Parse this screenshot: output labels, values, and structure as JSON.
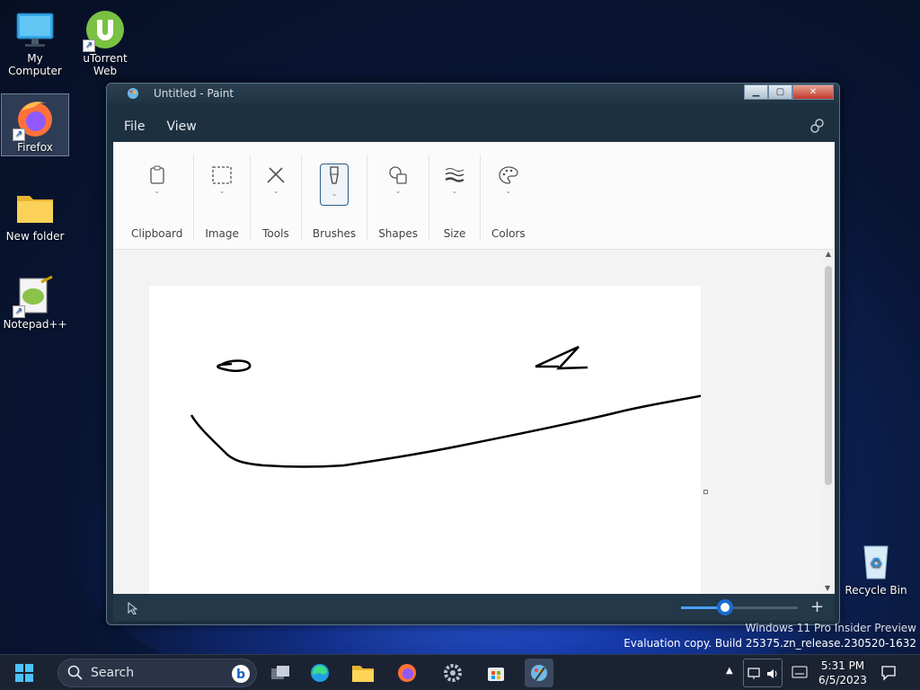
{
  "desktop": {
    "icons": [
      {
        "label": "My Computer"
      },
      {
        "label": "uTorrent Web"
      },
      {
        "label": "Firefox"
      },
      {
        "label": "New folder"
      },
      {
        "label": "Notepad++"
      },
      {
        "label": "Recycle Bin"
      }
    ],
    "watermark": {
      "line1": "Windows 11 Pro Insider Preview",
      "line2": "Evaluation copy. Build 25375.zn_release.230520-1632"
    }
  },
  "window": {
    "title": "Untitled - Paint",
    "menu": {
      "file": "File",
      "view": "View"
    },
    "ribbon": {
      "groups": [
        {
          "label": "Clipboard",
          "icon": "clipboard-icon"
        },
        {
          "label": "Image",
          "icon": "selection-icon"
        },
        {
          "label": "Tools",
          "icon": "tools-icon"
        },
        {
          "label": "Brushes",
          "icon": "brush-icon",
          "active": true
        },
        {
          "label": "Shapes",
          "icon": "shapes-icon"
        },
        {
          "label": "Size",
          "icon": "size-icon"
        },
        {
          "label": "Colors",
          "icon": "palette-icon"
        }
      ]
    },
    "zoom_fraction": 0.38
  },
  "taskbar": {
    "search_label": "Search",
    "clock": {
      "time": "5:31 PM",
      "date": "6/5/2023"
    }
  },
  "colors": {
    "accent": "#1a6bd0",
    "paint_frame": "#1d3040",
    "taskbar": "#1b2332"
  }
}
